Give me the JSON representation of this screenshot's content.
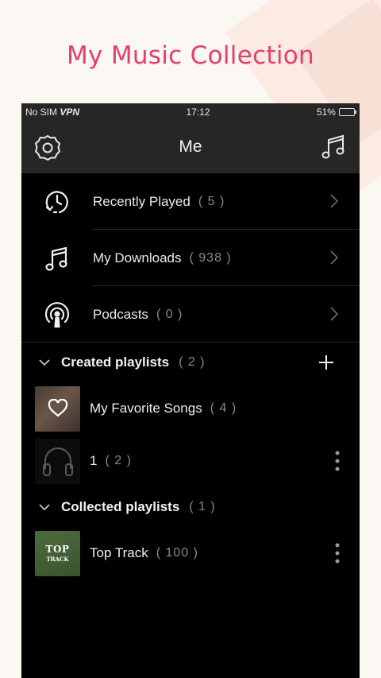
{
  "promo": {
    "title": "My Music Collection"
  },
  "status_bar": {
    "carrier": "No SIM",
    "vpn": "VPN",
    "time": "17:12",
    "battery": "51%",
    "battery_level": 0.51
  },
  "header": {
    "title": "Me",
    "left_icon": "settings-gear-icon",
    "right_icon": "music-note-icon"
  },
  "menu": [
    {
      "label": "Recently Played",
      "count": "( 5 )",
      "icon": "recent-clock-icon"
    },
    {
      "label": "My Downloads",
      "count": "( 938 )",
      "icon": "music-note-icon"
    },
    {
      "label": "Podcasts",
      "count": "( 0 )",
      "icon": "podcast-icon"
    }
  ],
  "created_playlists": {
    "title": "Created playlists",
    "count": "( 2 )",
    "items": [
      {
        "name": "My Favorite Songs",
        "count": "( 4 )",
        "thumb": "heart-icon"
      },
      {
        "name": "1",
        "count": "( 2 )",
        "thumb": "headphones-icon"
      }
    ]
  },
  "collected_playlists": {
    "title": "Collected playlists",
    "count": "( 1 )",
    "items": [
      {
        "name": "Top Track",
        "count": "( 100 )",
        "cover_line1": "TOP",
        "cover_line2": "TRACK"
      }
    ]
  },
  "colors": {
    "accent": "#e63d6d",
    "bar": "#262626",
    "background": "#000000",
    "muted": "#8a8a8a"
  }
}
